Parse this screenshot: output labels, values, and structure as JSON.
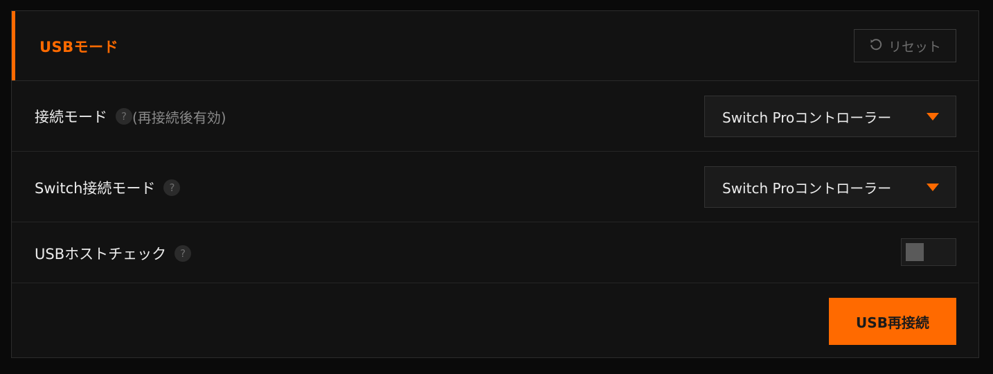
{
  "header": {
    "title": "USBモード",
    "reset_label": "リセット"
  },
  "settings": [
    {
      "label": "接続モード",
      "note": "(再接続後有効)",
      "help": "?",
      "value": "Switch Proコントローラー"
    },
    {
      "label": "Switch接続モード",
      "help": "?",
      "value": "Switch Proコントローラー"
    },
    {
      "label": "USBホストチェック",
      "help": "?",
      "toggle_on": false
    }
  ],
  "actions": {
    "reconnect_label": "USB再接続"
  },
  "colors": {
    "accent": "#ff6a00",
    "background": "#121212",
    "text": "#ececec"
  }
}
